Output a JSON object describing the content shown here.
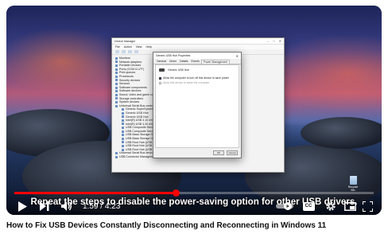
{
  "video": {
    "title": "How to Fix USB Devices Constantly Disconnecting and Reconnecting in Windows 11",
    "subtitle": "Repeat the steps to disable the power-saving option for other USB drivers.",
    "time_current": "1:59",
    "time_separator": " / ",
    "time_total": "4:23",
    "progress_fraction": 0.45,
    "accent_color": "#ff0000"
  },
  "controls": {
    "icons": [
      "play-icon",
      "next-icon",
      "volume-icon",
      "autoplay-toggle-icon",
      "captions-icon",
      "settings-icon",
      "miniplayer-icon",
      "fullscreen-icon"
    ],
    "captions_label": "CC"
  },
  "desktop": {
    "recycle_bin_label": "Recycle Bin"
  },
  "device_manager": {
    "title": "Device Manager",
    "menu": [
      "File",
      "Action",
      "View",
      "Help"
    ],
    "tree": [
      {
        "label": "Monitors",
        "child": false
      },
      {
        "label": "Network adapters",
        "child": false
      },
      {
        "label": "Portable Devices",
        "child": false
      },
      {
        "label": "Ports (COM & LPT)",
        "child": false
      },
      {
        "label": "Print queues",
        "child": false
      },
      {
        "label": "Processors",
        "child": false
      },
      {
        "label": "Security devices",
        "child": false
      },
      {
        "label": "Sensors",
        "child": false
      },
      {
        "label": "Software components",
        "child": false
      },
      {
        "label": "Software devices",
        "child": false
      },
      {
        "label": "Sound, video and game controllers",
        "child": false
      },
      {
        "label": "Storage controllers",
        "child": false
      },
      {
        "label": "System devices",
        "child": false
      },
      {
        "label": "Universal Serial Bus controllers",
        "child": false
      },
      {
        "label": "Generic SuperSpeed USB Hub",
        "child": true
      },
      {
        "label": "Generic USB Hub",
        "child": true
      },
      {
        "label": "Generic USB Hub",
        "child": true
      },
      {
        "label": "Intel(R) USB 3.10 eXtensible Host Controller",
        "child": true
      },
      {
        "label": "Intel(R) USB 3.20 eXtensible Host Controller",
        "child": true
      },
      {
        "label": "USB Composite Device",
        "child": true
      },
      {
        "label": "USB Composite Device",
        "child": true
      },
      {
        "label": "USB Mass Storage Device",
        "child": true
      },
      {
        "label": "USB Mass Storage Device",
        "child": true
      },
      {
        "label": "USB Root Hub (USB 3.0)",
        "child": true
      },
      {
        "label": "USB Root Hub (USB 3.0)",
        "child": true
      },
      {
        "label": "USB Root Hub (USB 3.0)",
        "child": true
      },
      {
        "label": "Universal Serial Bus devices",
        "child": false
      },
      {
        "label": "USB Connector Managers",
        "child": false
      }
    ]
  },
  "properties": {
    "title": "Generic USB Hub Properties",
    "tabs": [
      "General",
      "Driver",
      "Details",
      "Events",
      "Power Management"
    ],
    "device_name": "Generic USB Hub",
    "option1": "Allow the computer to turn off this device to save power",
    "option2": "Allow this device to wake the computer",
    "ok_label": "OK",
    "cancel_label": "Cancel"
  }
}
